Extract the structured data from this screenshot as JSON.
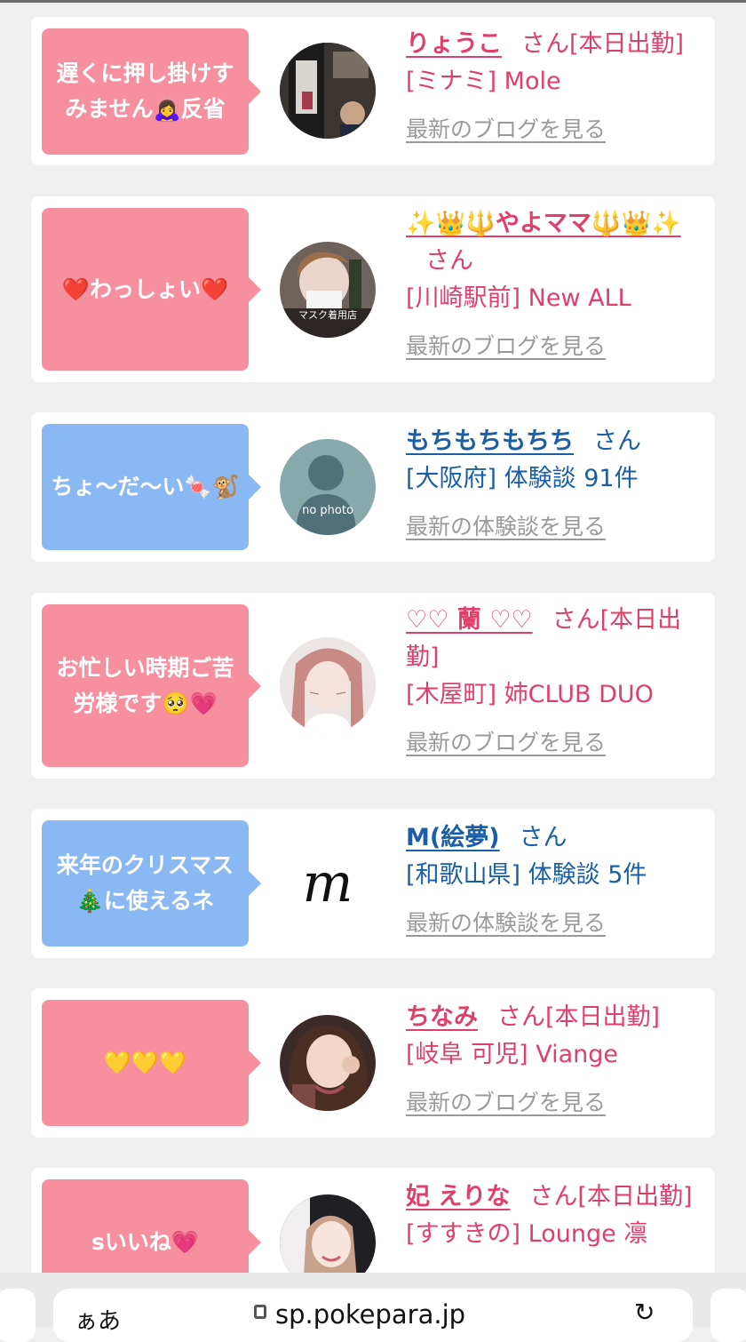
{
  "cards": [
    {
      "bubble": "遅くに押し掛けすみません🙇‍♀️反省",
      "bubble_color": "pink",
      "avatar": "photo-bar-interior",
      "name": "りょうこ",
      "san": "さん[本日出勤]",
      "sub": "[ミナミ] Mole",
      "link": "最新のブログを見る"
    },
    {
      "bubble": "❤️わっしょい❤️",
      "bubble_color": "pink",
      "avatar": "photo-woman-mask",
      "name": "✨👑🔱やよママ🔱👑✨",
      "san": "さん",
      "sub": "[川崎駅前] New ALL",
      "link": "最新のブログを見る"
    },
    {
      "bubble": "ちょ〜だ〜い🍬🐒",
      "bubble_color": "blue",
      "avatar_text": "no photo",
      "name": "もちもちもちち",
      "san": "さん",
      "sub": "[大阪府] 体験談 91件",
      "link": "最新の体験談を見る"
    },
    {
      "bubble": "お忙しい時期ご苦労様です🥺💗",
      "bubble_color": "pink",
      "avatar": "photo-woman-cat-filter",
      "name": "♡♡ 蘭 ♡♡",
      "san": "さん[本日出勤]",
      "sub": "[木屋町] 姉CLUB DUO",
      "link": "最新のブログを見る"
    },
    {
      "bubble": "来年のクリスマス🎄に使えるネ",
      "bubble_color": "blue",
      "avatar_text": "m",
      "name": "M(絵夢)",
      "san": "さん",
      "sub": "[和歌山県] 体験談 5件",
      "link": "最新の体験談を見る"
    },
    {
      "bubble": "💛💛💛",
      "bubble_color": "pink",
      "avatar": "photo-woman-wink",
      "name": "ちなみ",
      "san": "さん[本日出勤]",
      "sub": "[岐阜 可児] Viange",
      "link": "最新のブログを見る"
    },
    {
      "bubble": "sいいね💗",
      "bubble_color": "pink",
      "avatar": "photo-woman-smile",
      "name": "妃 えりな",
      "san": "さん[本日出勤]",
      "sub": "[すすきの] Lounge 凛"
    }
  ],
  "browser": {
    "left_text": "ぁあ",
    "url": "sp.pokepara.jp",
    "reload_icon": "reload-icon"
  },
  "colors": {
    "pink_bubble": "#f7909e",
    "blue_bubble": "#8ab8f2",
    "pink_text": "#e03f6a",
    "blue_text": "#1a5ea6"
  }
}
